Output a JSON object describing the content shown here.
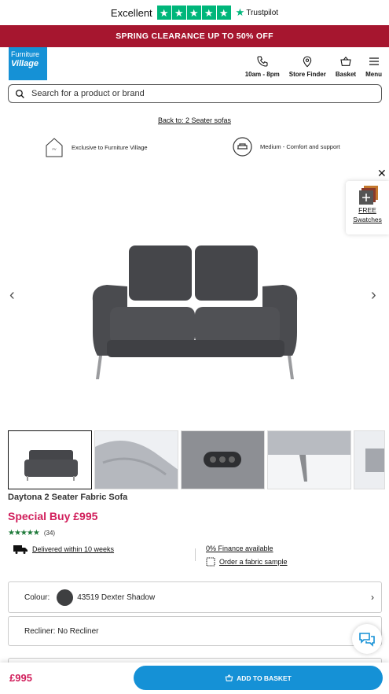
{
  "trustpilot": {
    "rating_word": "Excellent",
    "brand": "Trustpilot",
    "stars": 5,
    "color": "#00b67a"
  },
  "promo": {
    "text": "SPRING CLEARANCE UP TO 50% OFF",
    "color": "#a6162f"
  },
  "header": {
    "logo_line1": "Furniture",
    "logo_line2": "Village",
    "nav": [
      {
        "label": "10am - 8pm",
        "icon": "phone-icon"
      },
      {
        "label": "Store Finder",
        "icon": "location-pin-icon"
      },
      {
        "label": "Basket",
        "icon": "basket-icon"
      },
      {
        "label": "Menu",
        "icon": "hamburger-menu-icon"
      }
    ]
  },
  "search": {
    "placeholder": "Search for a product or brand"
  },
  "breadcrumb": {
    "back": "Back to: 2 Seater sofas"
  },
  "features": [
    {
      "text": "Exclusive to Furniture Village",
      "icon": "house-icon"
    },
    {
      "text": "Medium - Comfort and support",
      "icon": "comfort-icon"
    }
  ],
  "swatches": {
    "line1": "FREE",
    "line2": "Swatches"
  },
  "gallery": {
    "thumbs": [
      "front view",
      "arm detail",
      "recliner button",
      "leg detail",
      "side view"
    ]
  },
  "product": {
    "name": "Daytona 2 Seater Fabric Sofa",
    "price": "Special Buy £995",
    "rating": 4.5,
    "rating_stars": "★★★★★",
    "review_count": "(34)",
    "delivery": "Delivered within 10 weeks",
    "finance": "0% Finance available",
    "sample": "Order a fabric sample"
  },
  "options": {
    "colour_label": "Colour:",
    "colour_value": "43519 Dexter Shadow",
    "colour_hex": "#3e3f41",
    "recliner": "Recliner: No Recliner"
  },
  "footer_bar": {
    "price": "£995",
    "button": "ADD TO BASKET",
    "accent": "#1591d6"
  }
}
